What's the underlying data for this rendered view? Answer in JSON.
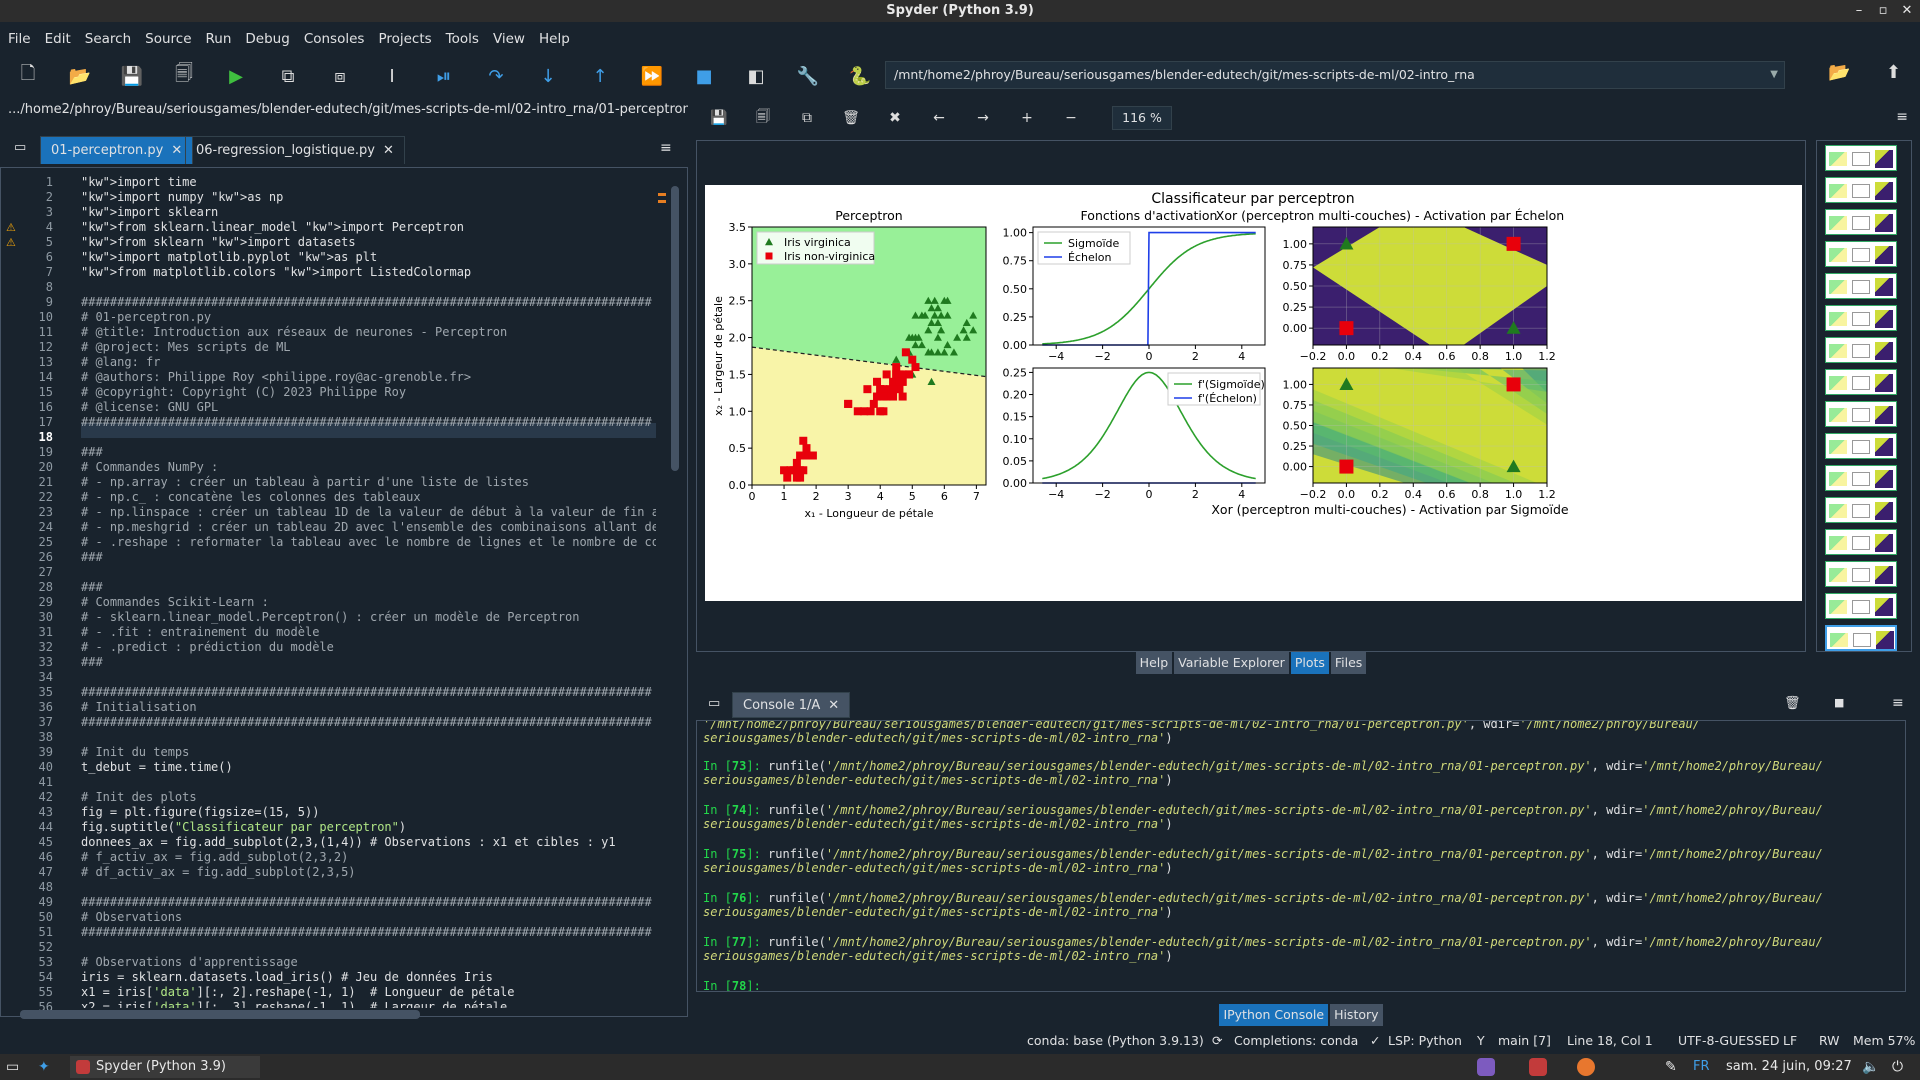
{
  "window": {
    "title": "Spyder (Python 3.9)",
    "min": "–",
    "max": "▫",
    "close": "✕"
  },
  "menu": [
    "File",
    "Edit",
    "Search",
    "Source",
    "Run",
    "Debug",
    "Consoles",
    "Projects",
    "Tools",
    "View",
    "Help"
  ],
  "toolbar": {
    "path": "/mnt/home2/phroy/Bureau/seriousgames/blender-edutech/git/mes-scripts-de-ml/02-intro_rna"
  },
  "editor": {
    "filepath": ".../home2/phroy/Bureau/seriousgames/blender-edutech/git/mes-scripts-de-ml/02-intro_rna/01-perceptron.py",
    "tabs": [
      "01-perceptron.py",
      "06-regression_logistique.py"
    ],
    "current_line": "18",
    "lines": [
      "import time",
      "import numpy as np",
      "import sklearn",
      "from sklearn.linear_model import Perceptron",
      "from sklearn import datasets",
      "import matplotlib.pyplot as plt",
      "from matplotlib.colors import ListedColormap",
      "",
      "###############################################################################",
      "# 01-perceptron.py",
      "# @title: Introduction aux réseaux de neurones - Perceptron",
      "# @project: Mes scripts de ML",
      "# @lang: fr",
      "# @authors: Philippe Roy <philippe.roy@ac-grenoble.fr>",
      "# @copyright: Copyright (C) 2023 Philippe Roy",
      "# @license: GNU GPL",
      "###############################################################################",
      "",
      "###",
      "# Commandes NumPy :",
      "# - np.array : créer un tableau à partir d'une liste de listes",
      "# - np.c_ : concatène les colonnes des tableaux",
      "# - np.linspace : créer un tableau 1D de la valeur de début à la valeur de fin a",
      "# - np.meshgrid : créer un tableau 2D avec l'ensemble des combinaisons allant de",
      "# - .reshape : reformater la tableau avec le nombre de lignes et le nombre de co",
      "###",
      "",
      "###",
      "# Commandes Scikit-Learn :",
      "# - sklearn.linear_model.Perceptron() : créer un modèle de Perceptron",
      "# - .fit : entrainement du modèle",
      "# - .predict : prédiction du modèle",
      "###",
      "",
      "###############################################################################",
      "# Initialisation",
      "###############################################################################",
      "",
      "# Init du temps",
      "t_debut = time.time()",
      "",
      "# Init des plots",
      "fig = plt.figure(figsize=(15, 5))",
      "fig.suptitle(\"Classificateur par perceptron\")",
      "donnees_ax = fig.add_subplot(2,3,(1,4)) # Observations : x1 et cibles : y1",
      "# f_activ_ax = fig.add_subplot(2,3,2)",
      "# df_activ_ax = fig.add_subplot(2,3,5)",
      "",
      "###############################################################################",
      "# Observations",
      "###############################################################################",
      "",
      "# Observations d'apprentissage",
      "iris = sklearn.datasets.load_iris() # Jeu de données Iris",
      "x1 = iris['data'][:, 2].reshape(-1, 1)  # Longueur de pétale",
      "x2 = iris['data'][:, 3].reshape(-1, 1)  # Largeur de pétale"
    ]
  },
  "plots": {
    "zoom": "116 %",
    "suptitle": "Classificateur par perceptron",
    "pane_tabs": [
      "Help",
      "Variable Explorer",
      "Plots",
      "Files"
    ]
  },
  "chart_data": [
    {
      "type": "scatter",
      "title": "Perceptron",
      "xlabel": "x₁ - Longueur de pétale",
      "ylabel": "x₂ - Largeur de pétale",
      "xlim": [
        0,
        7.3
      ],
      "ylim": [
        0,
        3.5
      ],
      "xticks": [
        "0",
        "1",
        "2",
        "3",
        "4",
        "5",
        "6",
        "7"
      ],
      "yticks": [
        "0.0",
        "0.5",
        "1.0",
        "1.5",
        "2.0",
        "2.5",
        "3.0",
        "3.5"
      ],
      "legend": "top-left",
      "series": [
        {
          "name": "Iris virginica",
          "color": "#1f7a1f",
          "points": [
            [
              4.5,
              1.7
            ],
            [
              4.8,
              1.8
            ],
            [
              4.9,
              1.8
            ],
            [
              5.0,
              1.5
            ],
            [
              5.1,
              1.9
            ],
            [
              5.1,
              2.0
            ],
            [
              5.3,
              2.3
            ],
            [
              5.5,
              2.1
            ],
            [
              5.6,
              2.2
            ],
            [
              5.7,
              2.3
            ],
            [
              5.8,
              2.2
            ],
            [
              5.9,
              2.3
            ],
            [
              6.0,
              2.5
            ],
            [
              6.1,
              2.3
            ],
            [
              6.6,
              2.1
            ],
            [
              6.9,
              2.3
            ],
            [
              6.7,
              2.0
            ],
            [
              6.4,
              2.0
            ],
            [
              5.6,
              1.8
            ],
            [
              5.4,
              2.3
            ],
            [
              5.2,
              2.0
            ],
            [
              5.8,
              1.8
            ],
            [
              6.1,
              1.9
            ],
            [
              6.0,
              1.8
            ],
            [
              5.5,
              1.8
            ],
            [
              5.1,
              2.3
            ],
            [
              5.6,
              2.4
            ],
            [
              5.7,
              2.5
            ],
            [
              6.3,
              1.8
            ],
            [
              5.8,
              2.4
            ],
            [
              4.9,
              2.0
            ],
            [
              5.5,
              2.5
            ],
            [
              6.7,
              2.2
            ],
            [
              6.9,
              2.1
            ],
            [
              5.6,
              1.4
            ],
            [
              5.0,
              2.0
            ],
            [
              5.3,
              1.9
            ],
            [
              5.9,
              2.1
            ],
            [
              6.1,
              2.5
            ],
            [
              5.8,
              2.0
            ]
          ]
        },
        {
          "name": "Iris non-virginica",
          "color": "#e8000b",
          "points": [
            [
              1.4,
              0.2
            ],
            [
              1.3,
              0.2
            ],
            [
              1.5,
              0.2
            ],
            [
              1.7,
              0.4
            ],
            [
              1.4,
              0.3
            ],
            [
              1.5,
              0.1
            ],
            [
              1.6,
              0.2
            ],
            [
              1.1,
              0.1
            ],
            [
              1.2,
              0.2
            ],
            [
              1.9,
              0.4
            ],
            [
              1.6,
              0.6
            ],
            [
              1.0,
              0.2
            ],
            [
              1.7,
              0.5
            ],
            [
              1.5,
              0.4
            ],
            [
              1.4,
              0.1
            ],
            [
              4.7,
              1.4
            ],
            [
              4.5,
              1.5
            ],
            [
              4.9,
              1.5
            ],
            [
              4.0,
              1.3
            ],
            [
              4.6,
              1.5
            ],
            [
              3.3,
              1.0
            ],
            [
              4.6,
              1.3
            ],
            [
              3.9,
              1.4
            ],
            [
              3.5,
              1.0
            ],
            [
              4.2,
              1.5
            ],
            [
              4.0,
              1.0
            ],
            [
              4.7,
              1.4
            ],
            [
              3.6,
              1.3
            ],
            [
              4.4,
              1.4
            ],
            [
              4.5,
              1.5
            ],
            [
              4.1,
              1.0
            ],
            [
              4.8,
              1.8
            ],
            [
              4.0,
              1.3
            ],
            [
              4.9,
              1.5
            ],
            [
              4.7,
              1.2
            ],
            [
              4.3,
              1.3
            ],
            [
              4.4,
              1.2
            ],
            [
              5.0,
              1.7
            ],
            [
              3.8,
              1.1
            ],
            [
              3.7,
              1.0
            ],
            [
              3.9,
              1.2
            ],
            [
              5.1,
              1.6
            ],
            [
              4.5,
              1.6
            ],
            [
              4.7,
              1.5
            ],
            [
              4.1,
              1.3
            ],
            [
              3.0,
              1.1
            ],
            [
              4.2,
              1.2
            ],
            [
              4.6,
              1.4
            ],
            [
              4.1,
              1.2
            ],
            [
              4.4,
              1.3
            ],
            [
              3.0,
              1.1
            ]
          ]
        }
      ],
      "decision_line": [
        [
          0,
          1.87
        ],
        [
          7.3,
          1.47
        ]
      ]
    },
    {
      "type": "line",
      "title": "Fonctions d'activation",
      "xlim": [
        -5,
        5
      ],
      "ylim": [
        0,
        1.05
      ],
      "xticks": [
        "−4",
        "−2",
        "0",
        "2",
        "4"
      ],
      "yticks": [
        "0.00",
        "0.25",
        "0.50",
        "0.75",
        "1.00"
      ],
      "legend": "top-left",
      "series": [
        {
          "name": "Sigmoïde",
          "color": "#2ca02c",
          "function": "sigmoid"
        },
        {
          "name": "Échelon",
          "color": "#1f3fe8",
          "function": "step"
        }
      ]
    },
    {
      "type": "line",
      "title": "",
      "xlim": [
        -5,
        5
      ],
      "ylim": [
        0,
        0.26
      ],
      "xticks": [
        "−4",
        "−2",
        "0",
        "2",
        "4"
      ],
      "yticks": [
        "0.00",
        "0.05",
        "0.10",
        "0.15",
        "0.20",
        "0.25"
      ],
      "legend": "top-right",
      "series": [
        {
          "name": "f'(Sigmoïde)",
          "color": "#2ca02c",
          "function": "dsigmoid"
        },
        {
          "name": "f'(Échelon)",
          "color": "#1f3fe8",
          "function": "zero"
        }
      ]
    },
    {
      "type": "heatmap",
      "title": "Xor (perceptron multi-couches) - Activation par Échelon",
      "xlim": [
        -0.2,
        1.2
      ],
      "ylim": [
        -0.2,
        1.2
      ],
      "xticks": [
        "−0.2",
        "0.0",
        "0.2",
        "0.4",
        "0.6",
        "0.8",
        "1.0",
        "1.2"
      ],
      "yticks": [
        "0.00",
        "0.25",
        "0.50",
        "0.75",
        "1.00"
      ],
      "points": [
        [
          0,
          1,
          "triangle"
        ],
        [
          1,
          1,
          "square"
        ],
        [
          0,
          0,
          "square"
        ],
        [
          1,
          0,
          "triangle"
        ]
      ]
    },
    {
      "type": "heatmap",
      "title": "Xor (perceptron multi-couches) - Activation par Sigmoïde",
      "xlim": [
        -0.2,
        1.2
      ],
      "ylim": [
        -0.2,
        1.2
      ],
      "xticks": [
        "−0.2",
        "0.0",
        "0.2",
        "0.4",
        "0.6",
        "0.8",
        "1.0",
        "1.2"
      ],
      "yticks": [
        "0.00",
        "0.25",
        "0.50",
        "0.75",
        "1.00"
      ],
      "points": [
        [
          0,
          1,
          "triangle"
        ],
        [
          1,
          1,
          "square"
        ],
        [
          0,
          0,
          "square"
        ],
        [
          1,
          0,
          "triangle"
        ]
      ]
    }
  ],
  "console": {
    "tab": "Console 1/A",
    "runs": [
      {
        "n": "73"
      },
      {
        "n": "74"
      },
      {
        "n": "75"
      },
      {
        "n": "76"
      },
      {
        "n": "77"
      }
    ],
    "run_prefix": "runfile(",
    "run_file": "'/mnt/home2/phroy/Bureau/seriousgames/blender-edutech/git/mes-scripts-de-ml/02-intro_rna/01-perceptron.py'",
    "run_wdir_label": ", wdir=",
    "run_wdir": "'/mnt/home2/phroy/Bureau/",
    "run_wdir_cont": "seriousgames/blender-edutech/git/mes-scripts-de-ml/02-intro_rna'",
    "last_prompt": "78",
    "tabs": [
      "IPython Console",
      "History"
    ]
  },
  "status": {
    "conda": "conda: base (Python 3.9.13)",
    "completions": "Completions: conda",
    "lsp": "LSP: Python",
    "git": "main [7]",
    "position": "Line 18, Col 1",
    "encoding": "UTF-8-GUESSED",
    "eol": "LF",
    "rw": "RW",
    "mem": "Mem 57%"
  },
  "taskbar": {
    "app": "Spyder (Python 3.9)",
    "lang": "FR",
    "clock": "sam. 24 juin, 09:27"
  }
}
